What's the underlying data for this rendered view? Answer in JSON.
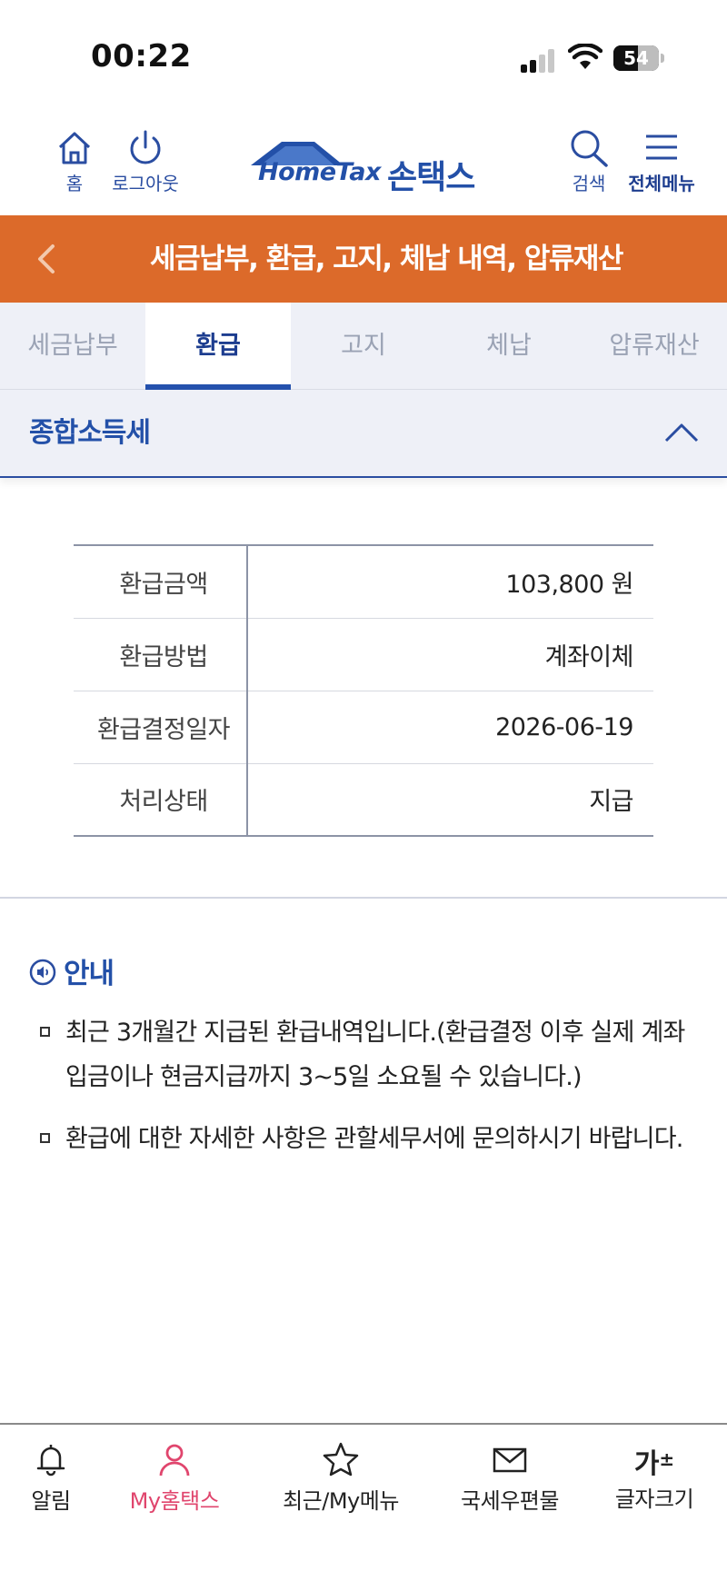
{
  "status_bar": {
    "time": "00:22",
    "battery": "54"
  },
  "header": {
    "home_label": "홈",
    "logout_label": "로그아웃",
    "logo_hometax": "HomeTax",
    "logo_sontax": "손택스",
    "search_label": "검색",
    "menu_label": "전체메뉴"
  },
  "title_bar": {
    "title": "세금납부, 환급, 고지, 체납 내역, 압류재산"
  },
  "tabs": [
    {
      "label": "세금납부",
      "active": false
    },
    {
      "label": "환급",
      "active": true
    },
    {
      "label": "고지",
      "active": false
    },
    {
      "label": "체납",
      "active": false
    },
    {
      "label": "압류재산",
      "active": false
    }
  ],
  "section": {
    "title": "종합소득세"
  },
  "details": [
    {
      "label": "환급금액",
      "value": "103,800 원"
    },
    {
      "label": "환급방법",
      "value": "계좌이체"
    },
    {
      "label": "환급결정일자",
      "value": "2026-06-19"
    },
    {
      "label": "처리상태",
      "value": "지급"
    }
  ],
  "notice": {
    "heading": "안내",
    "items": [
      "최근 3개월간 지급된 환급내역입니다.(환급결정 이후 실제 계좌 입금이나 현금지급까지 3~5일 소요될 수 있습니다.)",
      "환급에 대한 자세한 사항은 관할세무서에 문의하시기 바랍니다."
    ]
  },
  "bottom_nav": {
    "alert_label": "알림",
    "myhometax_label": "My홈택스",
    "recent_label": "최근/My메뉴",
    "mail_label": "국세우편물",
    "fontsize_glyph": "가",
    "fontsize_sign": "±",
    "fontsize_label": "글자크기"
  },
  "colors": {
    "brand_blue": "#2350a8",
    "title_orange": "#dc6a2a",
    "active_pink": "#e0456d"
  }
}
